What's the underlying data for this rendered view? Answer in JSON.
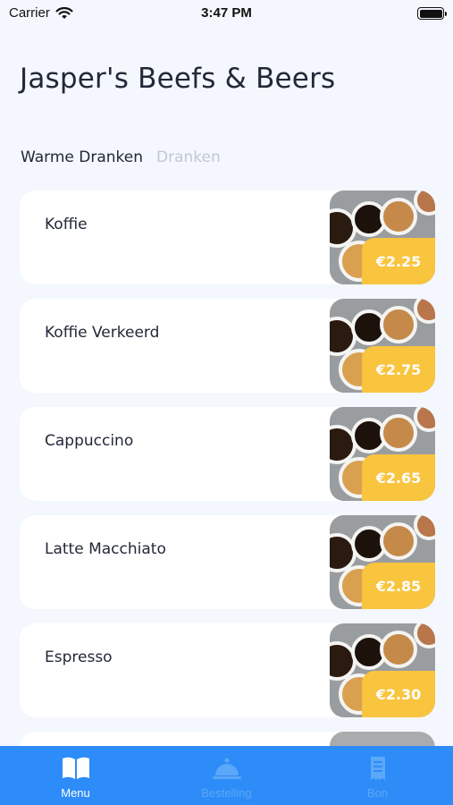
{
  "status": {
    "carrier": "Carrier",
    "time": "3:47 PM"
  },
  "header": {
    "title": "Jasper's Beefs & Beers"
  },
  "tabs": [
    {
      "label": "Warme Dranken",
      "active": true
    },
    {
      "label": "Dranken",
      "active": false
    }
  ],
  "menu_items": [
    {
      "name": "Koffie",
      "price": "€2.25"
    },
    {
      "name": "Koffie Verkeerd",
      "price": "€2.75"
    },
    {
      "name": "Cappuccino",
      "price": "€2.65"
    },
    {
      "name": "Latte Macchiato",
      "price": "€2.85"
    },
    {
      "name": "Espresso",
      "price": "€2.30"
    }
  ],
  "tabbar": [
    {
      "label": "Menu",
      "icon": "book-icon",
      "active": true
    },
    {
      "label": "Bestelling",
      "icon": "cloche-icon",
      "active": false
    },
    {
      "label": "Bon",
      "icon": "receipt-icon",
      "active": false
    }
  ],
  "colors": {
    "accent": "#2d8cf7",
    "price_badge": "#f9c43e",
    "background": "#f4f7fd"
  }
}
